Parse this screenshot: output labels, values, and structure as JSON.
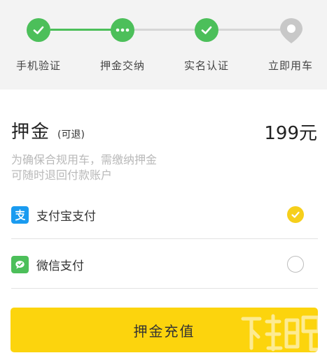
{
  "stepper": {
    "steps": [
      {
        "label": "手机验证",
        "status": "done"
      },
      {
        "label": "押金交纳",
        "status": "current"
      },
      {
        "label": "实名认证",
        "status": "done"
      },
      {
        "label": "立即用车",
        "status": "pending"
      }
    ]
  },
  "deposit": {
    "title": "押金",
    "refundable": "(可退)",
    "amount": "199元",
    "note_line1": "为确保合规用车，需缴纳押金",
    "note_line2": "可随时退回付款账户"
  },
  "payment": {
    "options": [
      {
        "label": "支付宝支付",
        "icon": "alipay-icon",
        "selected": true
      },
      {
        "label": "微信支付",
        "icon": "wechat-pay-icon",
        "selected": false
      }
    ]
  },
  "submit": {
    "label": "押金充值"
  },
  "colors": {
    "step_green": "#4cbf5a",
    "step_gray": "#d6d6d6",
    "accent_yellow": "#fcd40d",
    "alipay_blue": "#1a9bf0",
    "wechat_green": "#4cbf5a"
  }
}
